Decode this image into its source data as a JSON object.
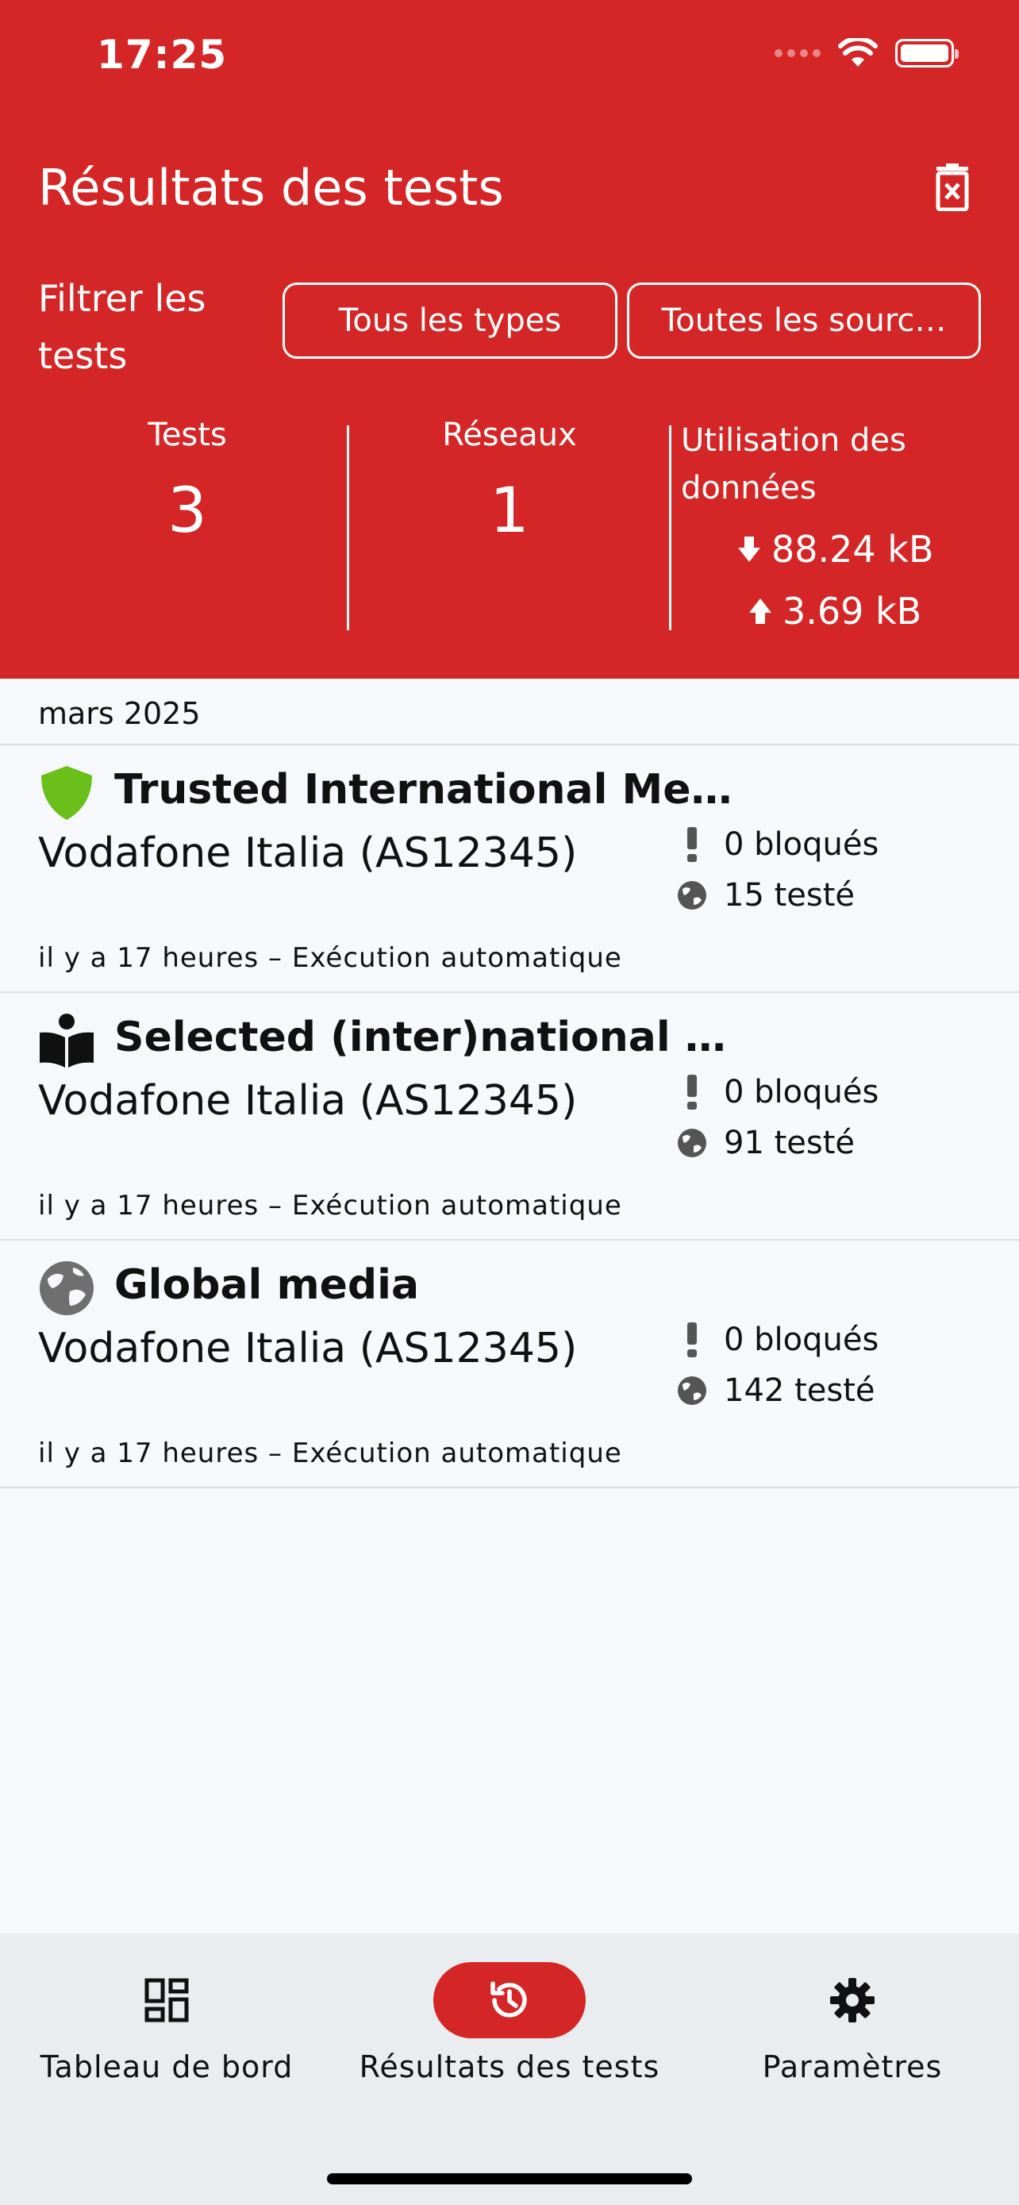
{
  "status_bar": {
    "time": "17:25"
  },
  "header": {
    "title": "Résultats des tests",
    "filter_label": "Filtrer les tests",
    "filter_types": "Tous les types",
    "filter_sources": "Toutes les sourc…"
  },
  "stats": {
    "tests_label": "Tests",
    "tests_value": "3",
    "networks_label": "Réseaux",
    "networks_value": "1",
    "data_label": "Utilisation des données",
    "download": "88.24 kB",
    "upload": "3.69 kB"
  },
  "month": "mars 2025",
  "results": [
    {
      "icon": "shield-icon",
      "icon_color": "#6bbf1a",
      "title": "Trusted International Me…",
      "network": "Vodafone Italia (AS12345)",
      "meta": "il y a 17 heures – Exécution automatique",
      "blocked": "0 bloqués",
      "tested": "15 testé"
    },
    {
      "icon": "book-reader-icon",
      "icon_color": "#111111",
      "title": "Selected (inter)national …",
      "network": "Vodafone Italia (AS12345)",
      "meta": "il y a 17 heures – Exécution automatique",
      "blocked": "0 bloqués",
      "tested": "91 testé"
    },
    {
      "icon": "globe-icon",
      "icon_color": "#6f6f6f",
      "title": "Global media",
      "network": "Vodafone Italia (AS12345)",
      "meta": "il y a 17 heures – Exécution automatique",
      "blocked": "0 bloqués",
      "tested": "142 testé"
    }
  ],
  "bottom_nav": {
    "dashboard": "Tableau de bord",
    "results": "Résultats des tests",
    "settings": "Paramètres",
    "active": "results"
  },
  "colors": {
    "primary": "#d42626",
    "background": "#f6f8fc",
    "nav_bg": "#e9edf0"
  }
}
